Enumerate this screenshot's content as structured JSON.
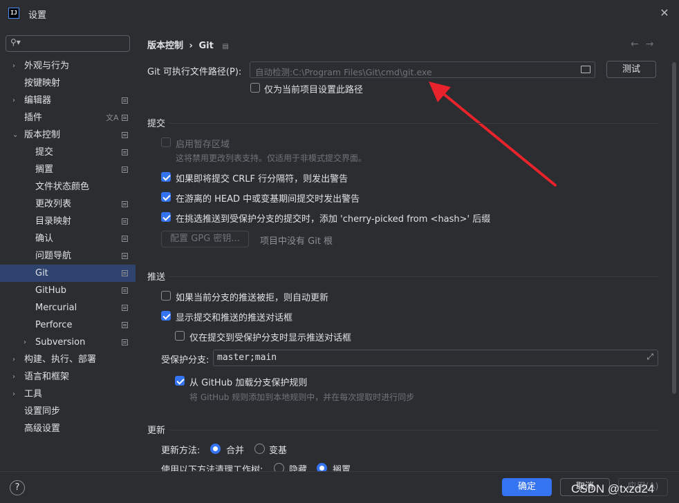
{
  "window": {
    "title": "设置",
    "app_icon": "IJ"
  },
  "search": {
    "placeholder": ""
  },
  "sidebar": {
    "items": [
      {
        "label": "外观与行为",
        "expand": "›"
      },
      {
        "label": "按键映射"
      },
      {
        "label": "编辑器",
        "expand": "›"
      },
      {
        "label": "插件"
      },
      {
        "label": "版本控制",
        "expand": "⌄"
      },
      {
        "label": "提交"
      },
      {
        "label": "搁置"
      },
      {
        "label": "文件状态颜色"
      },
      {
        "label": "更改列表"
      },
      {
        "label": "目录映射"
      },
      {
        "label": "确认"
      },
      {
        "label": "问题导航"
      },
      {
        "label": "Git"
      },
      {
        "label": "GitHub"
      },
      {
        "label": "Mercurial"
      },
      {
        "label": "Perforce"
      },
      {
        "label": "Subversion",
        "expand": "›"
      },
      {
        "label": "构建、执行、部署",
        "expand": "›"
      },
      {
        "label": "语言和框架",
        "expand": "›"
      },
      {
        "label": "工具",
        "expand": "›"
      },
      {
        "label": "设置同步"
      },
      {
        "label": "高级设置"
      }
    ],
    "selected": "Git"
  },
  "breadcrumb": {
    "parent": "版本控制",
    "sep": "›",
    "current": "Git"
  },
  "git_path": {
    "label": "Git 可执行文件路径(P):",
    "placeholder": "自动检测:C:\\Program Files\\Git\\cmd\\git.exe",
    "test_button": "测试",
    "project_only": "仅为当前项目设置此路径"
  },
  "commit": {
    "header": "提交",
    "staging": "启用暂存区域",
    "staging_hint": "这将禁用更改列表支持。仅适用于非模式提交界面。",
    "crlf": "如果即将提交 CRLF 行分隔符，则发出警告",
    "detached": "在游离的 HEAD 中或变基期间提交时发出警告",
    "cherry": "在挑选推送到受保护分支的提交时，添加 'cherry-picked from <hash>' 后缀",
    "gpg_button": "配置 GPG 密钥...",
    "gpg_hint": "项目中没有 Git 根"
  },
  "push": {
    "header": "推送",
    "auto_update": "如果当前分支的推送被拒，则自动更新",
    "show_dialog": "显示提交和推送的推送对话框",
    "only_protected": "仅在提交到受保护分支时显示推送对话框",
    "protected_label": "受保护分支:",
    "protected_value": "master;main",
    "load_github": "从 GitHub 加载分支保护规则",
    "load_hint": "将 GitHub 规则添加到本地规则中，并在每次提取时进行同步"
  },
  "update": {
    "header": "更新",
    "method_label": "更新方法:",
    "merge": "合并",
    "rebase": "变基",
    "clean_label": "使用以下方法清理工作树:",
    "stash": "隐藏",
    "shelve": "搁置"
  },
  "footer": {
    "help": "?",
    "ok": "确定",
    "cancel": "取消",
    "apply": "应用(A)"
  },
  "watermark": "CSDN @txzd24",
  "colors": {
    "accent": "#3574f0",
    "selection": "#2e436e",
    "annotation_arrow": "#e8232b"
  }
}
